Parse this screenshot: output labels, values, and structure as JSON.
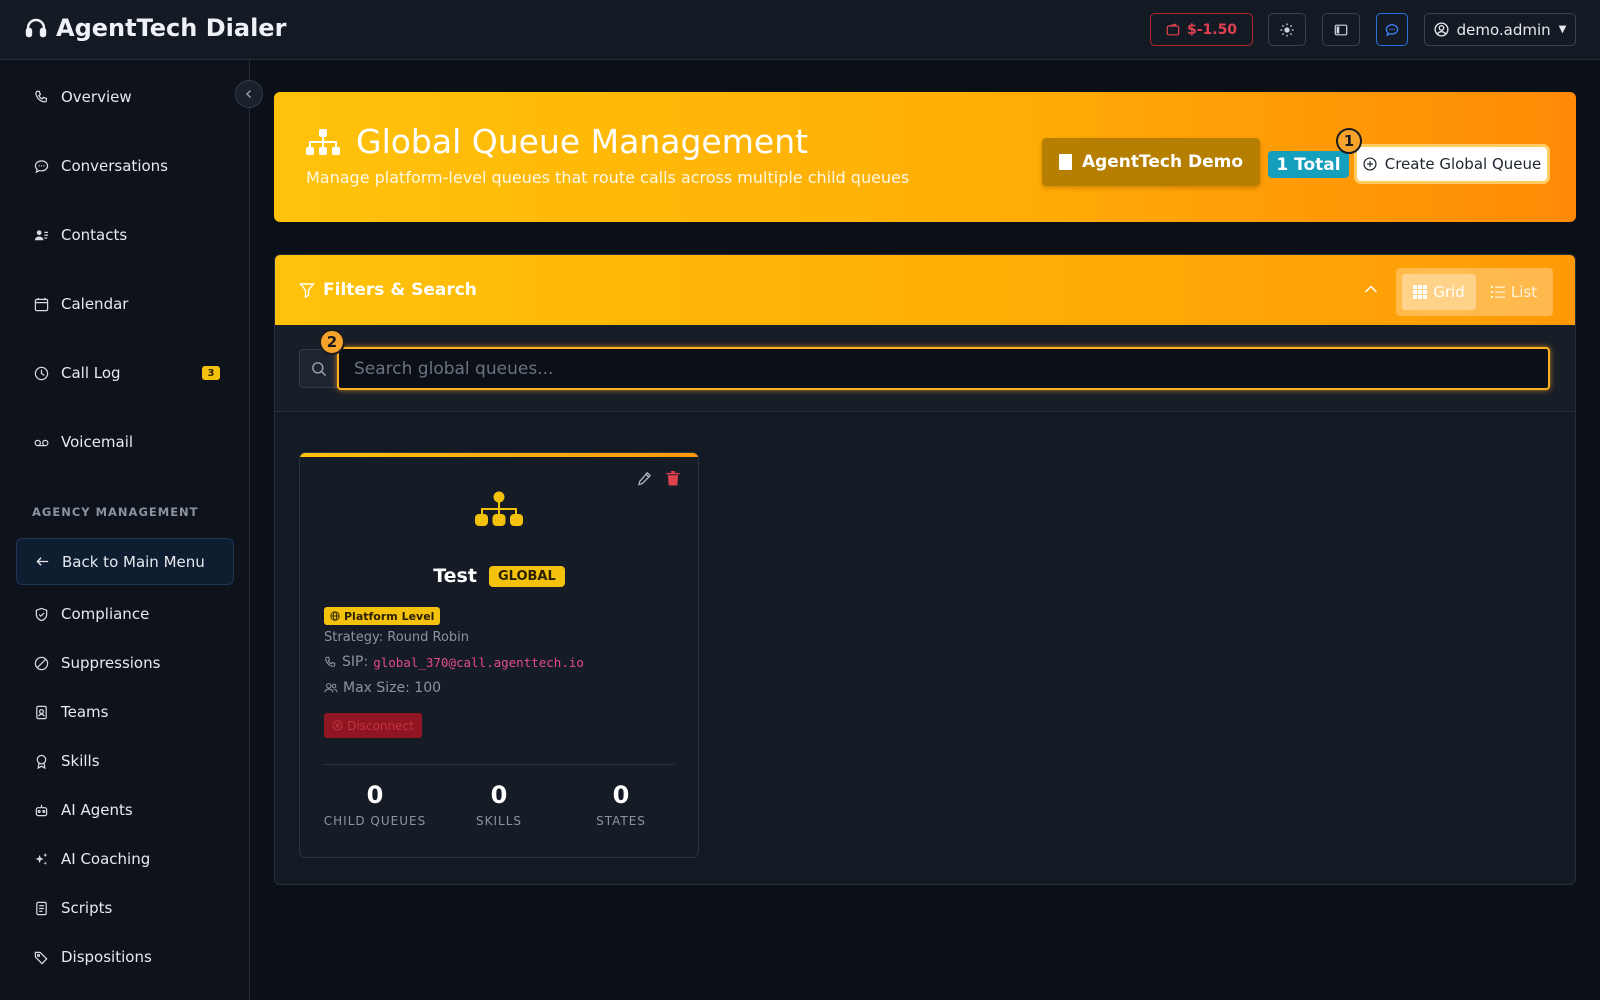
{
  "app": {
    "title": "AgentTech Dialer",
    "wallet_balance": "$-1.50",
    "user_name": "demo.admin"
  },
  "sidebar": {
    "items": [
      {
        "label": "Overview",
        "icon": "phone-icon"
      },
      {
        "label": "Conversations",
        "icon": "chat-icon"
      },
      {
        "label": "Contacts",
        "icon": "contacts-icon"
      },
      {
        "label": "Calendar",
        "icon": "calendar-icon"
      },
      {
        "label": "Call Log",
        "icon": "clock-icon",
        "badge": "3"
      },
      {
        "label": "Voicemail",
        "icon": "voicemail-icon"
      }
    ],
    "section_label": "AGENCY MANAGEMENT",
    "back_label": "Back to Main Menu",
    "agency_items": [
      {
        "label": "Compliance",
        "icon": "shield-icon"
      },
      {
        "label": "Suppressions",
        "icon": "ban-icon"
      },
      {
        "label": "Teams",
        "icon": "badge-icon"
      },
      {
        "label": "Skills",
        "icon": "award-icon"
      },
      {
        "label": "AI Agents",
        "icon": "robot-icon"
      },
      {
        "label": "AI Coaching",
        "icon": "sparkle-icon"
      },
      {
        "label": "Scripts",
        "icon": "file-icon"
      },
      {
        "label": "Dispositions",
        "icon": "tag-icon"
      }
    ]
  },
  "header": {
    "title": "Global Queue Management",
    "subtitle": "Manage platform-level queues that route calls across multiple child queues",
    "org_label": "AgentTech Demo",
    "total_label": "1 Total",
    "create_label": "Create Global Queue",
    "marker_1": "1"
  },
  "filters": {
    "title": "Filters & Search",
    "grid_label": "Grid",
    "list_label": "List",
    "search_placeholder": "Search global queues...",
    "marker_2": "2"
  },
  "queues": [
    {
      "name": "Test",
      "scope_badge": "GLOBAL",
      "level_badge": "Platform Level",
      "strategy": "Strategy: Round Robin",
      "sip_label": "SIP:",
      "sip_address": "global_370@call.agenttech.io",
      "max_size": "Max Size: 100",
      "disconnect_label": "Disconnect",
      "stats": [
        {
          "value": "0",
          "label": "CHILD QUEUES"
        },
        {
          "value": "0",
          "label": "SKILLS"
        },
        {
          "value": "0",
          "label": "STATES"
        }
      ]
    }
  ],
  "colors": {
    "accent": "#ffb020",
    "badge_yellow": "#f4c20d",
    "total_teal": "#14a0bd",
    "danger": "#e0414f"
  }
}
